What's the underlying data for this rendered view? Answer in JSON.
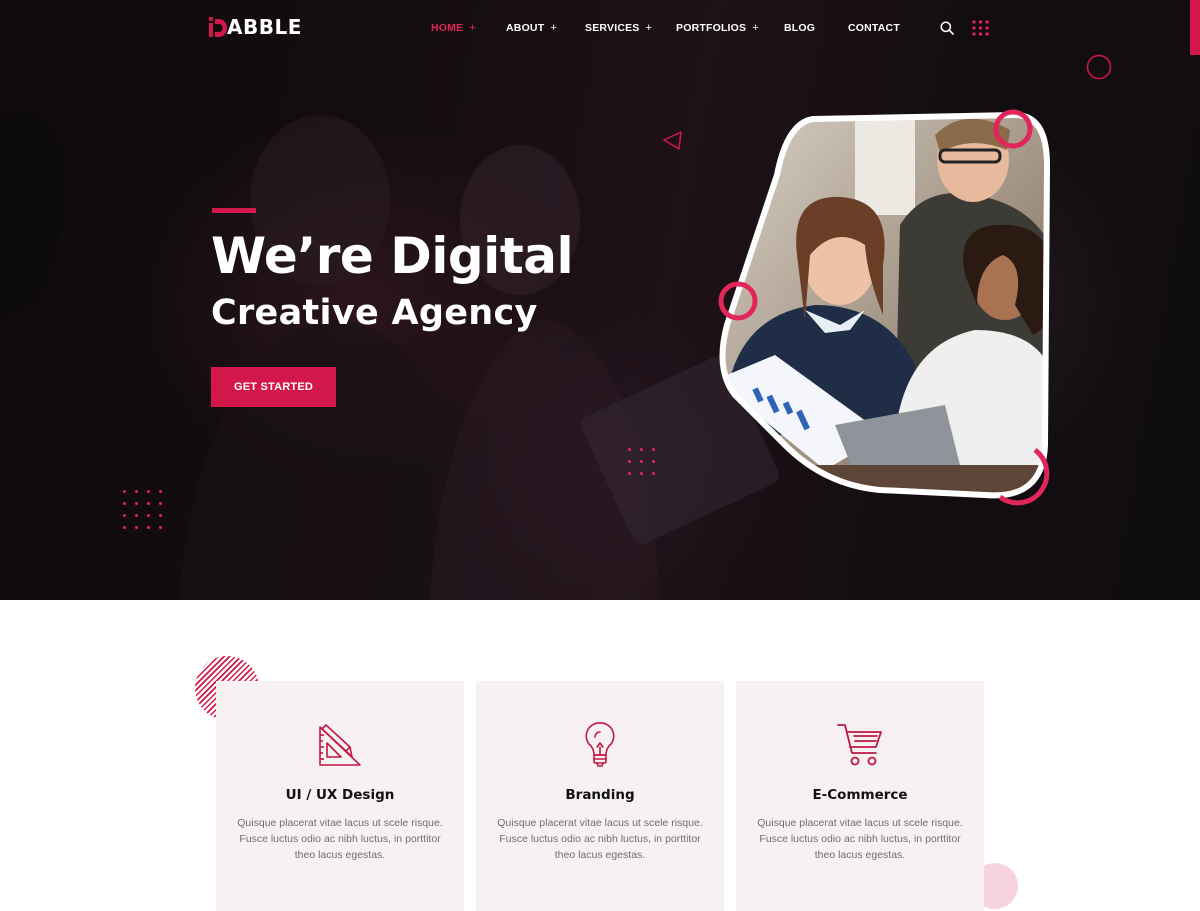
{
  "brand": {
    "logo_text": "ABBLE",
    "accent_color": "#d3174b"
  },
  "nav": {
    "items": [
      {
        "label": "HOME",
        "has_submenu": true,
        "active": true
      },
      {
        "label": "ABOUT",
        "has_submenu": true,
        "active": false
      },
      {
        "label": "SERVICES",
        "has_submenu": true,
        "active": false
      },
      {
        "label": "PORTFOLIOS",
        "has_submenu": true,
        "active": false
      },
      {
        "label": "BLOG",
        "has_submenu": false,
        "active": false
      },
      {
        "label": "CONTACT",
        "has_submenu": false,
        "active": false
      }
    ],
    "submenu_indicator": "+",
    "icons": [
      "search-icon",
      "grid-menu-icon"
    ]
  },
  "hero": {
    "title": "We’re Digital",
    "subtitle": "Creative Agency",
    "cta_label": "GET STARTED"
  },
  "services": [
    {
      "icon": "design-tools-icon",
      "title": "UI / UX Design",
      "text": "Quisque placerat vitae lacus ut scele risque. Fusce luctus odio ac nibh luctus, in porttitor theo lacus egestas."
    },
    {
      "icon": "lightbulb-icon",
      "title": "Branding",
      "text": "Quisque placerat vitae lacus ut scele risque. Fusce luctus odio ac nibh luctus, in porttitor theo lacus egestas."
    },
    {
      "icon": "shopping-cart-icon",
      "title": "E-Commerce",
      "text": "Quisque placerat vitae lacus ut scele risque. Fusce luctus odio ac nibh luctus, in porttitor theo lacus egestas."
    }
  ]
}
